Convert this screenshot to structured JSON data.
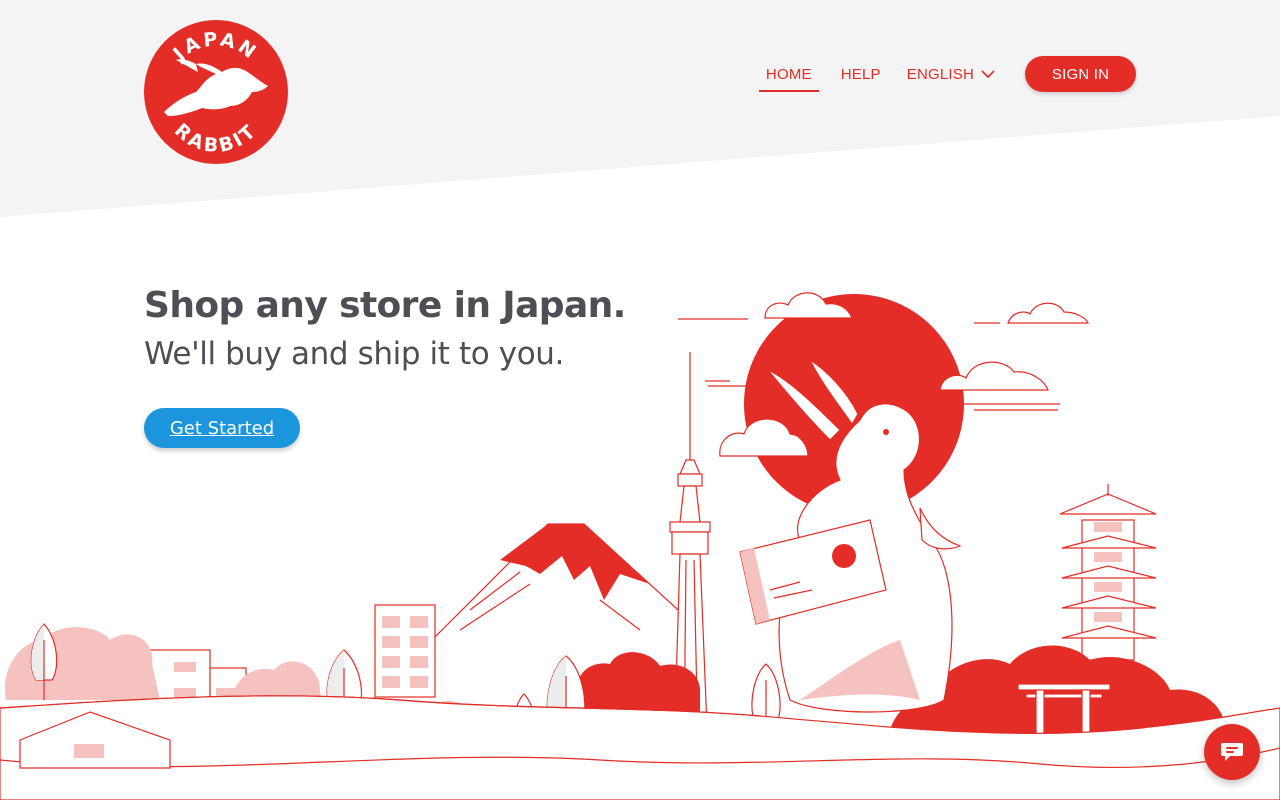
{
  "brand": {
    "name_top": "JAPAN",
    "name_bottom": "RABBIT",
    "red": "#e32d26",
    "blue": "#1b95db"
  },
  "nav": {
    "home": "HOME",
    "help": "HELP",
    "language": "ENGLISH",
    "sign_in": "SIGN IN",
    "active": "HOME"
  },
  "hero": {
    "headline": "Shop any store in Japan.",
    "subheadline": "We'll buy and ship it to you.",
    "cta": "Get Started"
  },
  "icons": {
    "logo": "rabbit-logo",
    "language_chevron": "chevron-down-icon",
    "chat": "chat-bubble-icon"
  }
}
